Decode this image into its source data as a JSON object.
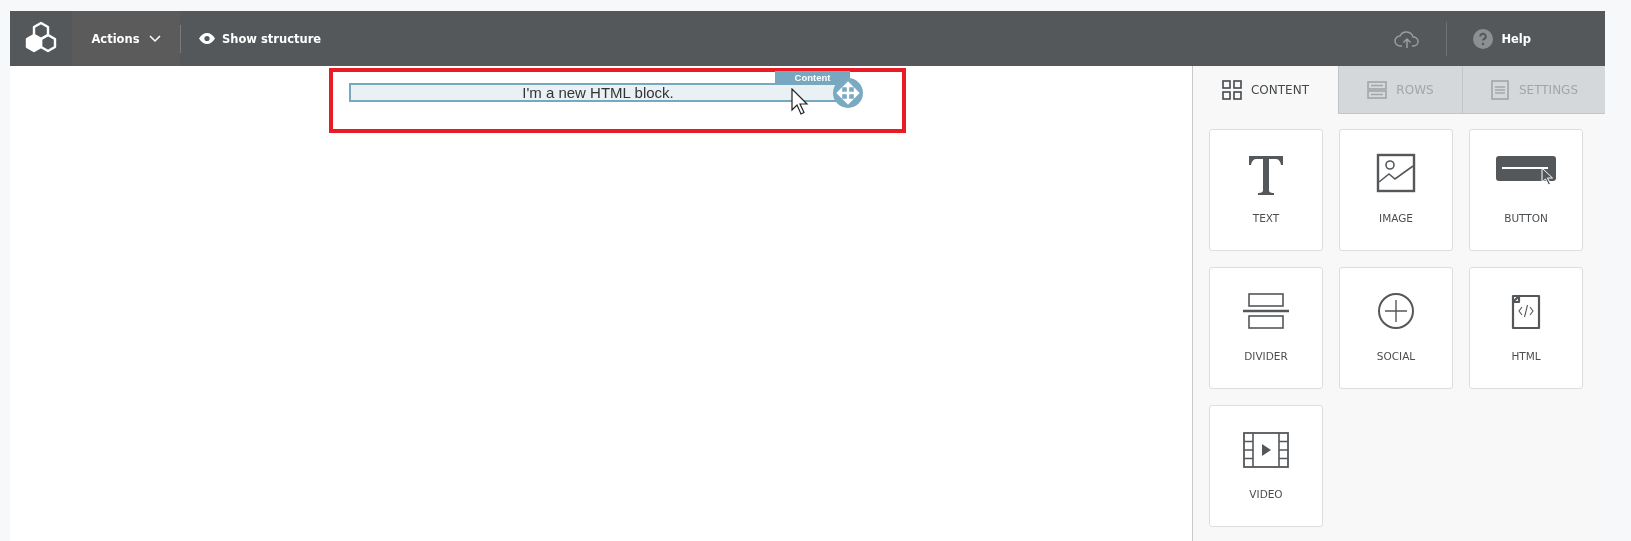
{
  "toolbar": {
    "actions_menu": {
      "label": "Actions"
    },
    "show_structure": {
      "label": "Show structure"
    },
    "help": {
      "label": "Help"
    }
  },
  "canvas": {
    "block": {
      "text": "I'm a new HTML block.",
      "tag": "Content",
      "highlighted": true
    }
  },
  "sidebar": {
    "tabs": [
      {
        "label": "CONTENT",
        "selected": true
      },
      {
        "label": "ROWS",
        "selected": false
      },
      {
        "label": "SETTINGS",
        "selected": false
      }
    ],
    "blocks": [
      {
        "label": "TEXT"
      },
      {
        "label": "IMAGE"
      },
      {
        "label": "BUTTON"
      },
      {
        "label": "DIVIDER"
      },
      {
        "label": "SOCIAL"
      },
      {
        "label": "HTML"
      },
      {
        "label": "VIDEO"
      }
    ]
  }
}
